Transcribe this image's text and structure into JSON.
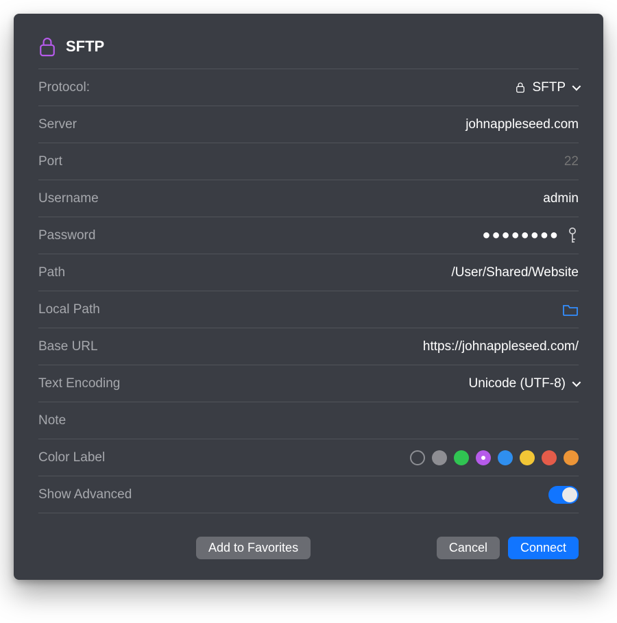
{
  "header": {
    "icon": "lock-icon",
    "title": "SFTP"
  },
  "fields": {
    "protocol": {
      "label": "Protocol:",
      "value": "SFTP"
    },
    "server": {
      "label": "Server",
      "value": "johnappleseed.com"
    },
    "port": {
      "label": "Port",
      "placeholder": "22",
      "value": ""
    },
    "username": {
      "label": "Username",
      "value": "admin"
    },
    "password": {
      "label": "Password",
      "value_masked": "●●●●●●●●"
    },
    "path": {
      "label": "Path",
      "value": "/User/Shared/Website"
    },
    "local_path": {
      "label": "Local Path",
      "value": ""
    },
    "base_url": {
      "label": "Base URL",
      "value": "https://johnappleseed.com/"
    },
    "text_encoding": {
      "label": "Text Encoding",
      "value": "Unicode (UTF-8)"
    },
    "note": {
      "label": "Note",
      "value": ""
    },
    "color_label": {
      "label": "Color Label",
      "colors": [
        {
          "name": "none",
          "hex": "transparent",
          "selected": false
        },
        {
          "name": "gray",
          "hex": "#8e8e93",
          "selected": false
        },
        {
          "name": "green",
          "hex": "#30c452",
          "selected": false
        },
        {
          "name": "purple",
          "hex": "#b65bea",
          "selected": true
        },
        {
          "name": "blue",
          "hex": "#2f8fef",
          "selected": false
        },
        {
          "name": "yellow",
          "hex": "#f2c636",
          "selected": false
        },
        {
          "name": "red",
          "hex": "#e55c4a",
          "selected": false
        },
        {
          "name": "orange",
          "hex": "#ed9537",
          "selected": false
        }
      ]
    },
    "show_advanced": {
      "label": "Show Advanced",
      "enabled": true
    }
  },
  "buttons": {
    "add_to_favorites": "Add to Favorites",
    "cancel": "Cancel",
    "connect": "Connect"
  },
  "accent_color": "#b65bea"
}
